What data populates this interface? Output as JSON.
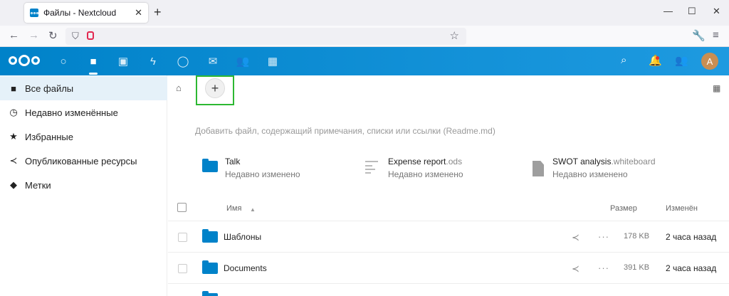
{
  "browser": {
    "tab_title": "Файлы - Nextcloud",
    "tab_close": "✕",
    "new_tab": "+",
    "window_controls": [
      "—",
      "☐",
      "✕"
    ]
  },
  "nc_header": {
    "apps": [
      "dashboard-icon",
      "files-icon",
      "photos-icon",
      "activity-icon",
      "talk-icon",
      "mail-icon",
      "contacts-icon",
      "calendar-icon"
    ],
    "avatar_letter": "A"
  },
  "sidebar": {
    "items": [
      {
        "label": "Все файлы",
        "icon": "folder-icon"
      },
      {
        "label": "Недавно изменённые",
        "icon": "clock-icon"
      },
      {
        "label": "Избранные",
        "icon": "star-icon"
      },
      {
        "label": "Опубликованные ресурсы",
        "icon": "share-icon"
      },
      {
        "label": "Метки",
        "icon": "tag-icon"
      }
    ]
  },
  "main": {
    "new_button": "+",
    "rich_workspace_hint": "Добавить файл, содержащий примечания, списки или ссылки (Readme.md)",
    "recommendations": [
      {
        "name": "Talk",
        "ext": "",
        "subtitle": "Недавно изменено",
        "icon": "folder-icon"
      },
      {
        "name": "Expense report",
        "ext": ".ods",
        "subtitle": "Недавно изменено",
        "icon": "spreadsheet-icon"
      },
      {
        "name": "SWOT analysis",
        "ext": ".whiteboard",
        "subtitle": "Недавно изменено",
        "icon": "document-icon"
      }
    ],
    "table": {
      "headers": {
        "name": "Имя",
        "size": "Размер",
        "modified": "Изменён"
      },
      "sort_indicator": "▲",
      "rows": [
        {
          "name": "Шаблоны",
          "size": "178 KB",
          "modified": "2 часа назад"
        },
        {
          "name": "Documents",
          "size": "391 KB",
          "modified": "2 часа назад"
        }
      ]
    }
  }
}
